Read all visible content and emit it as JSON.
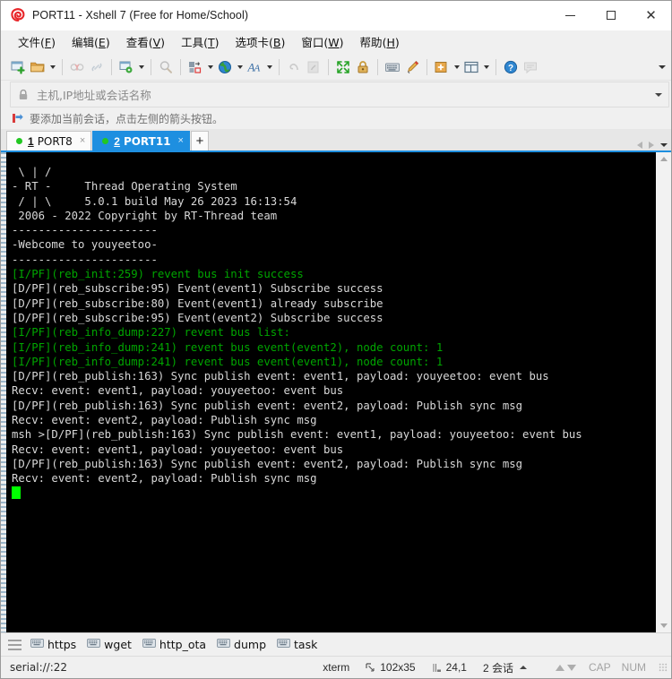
{
  "window": {
    "title": "PORT11 - Xshell 7 (Free for Home/School)",
    "logo_icon": "xshell-spiral-logo",
    "minimize_label": "Minimize",
    "maximize_label": "Maximize",
    "close_label": "Close"
  },
  "menu": {
    "items": [
      {
        "text": "文件",
        "accel": "F"
      },
      {
        "text": "编辑",
        "accel": "E"
      },
      {
        "text": "查看",
        "accel": "V"
      },
      {
        "text": "工具",
        "accel": "T"
      },
      {
        "text": "选项卡",
        "accel": "B"
      },
      {
        "text": "窗口",
        "accel": "W"
      },
      {
        "text": "帮助",
        "accel": "H"
      }
    ]
  },
  "toolbar": {
    "buttons": [
      {
        "icon": "new-session-icon",
        "label": "新建",
        "dropdown": false,
        "dim": false
      },
      {
        "icon": "open-folder-icon",
        "label": "打开",
        "dropdown": true,
        "dim": false
      },
      {
        "icon": "disconnect-icon",
        "label": "断开",
        "dim": true,
        "dropdown": false
      },
      {
        "icon": "reconnect-link-icon",
        "label": "重新连接",
        "dim": true,
        "dropdown": false
      },
      {
        "icon": "session-properties-icon",
        "label": "属性",
        "dropdown": true,
        "dim": false
      },
      {
        "icon": "search-icon",
        "label": "查找",
        "dim": true,
        "dropdown": false
      },
      {
        "icon": "layout-transfer-icon",
        "label": "传输",
        "dropdown": true,
        "dim": false
      },
      {
        "icon": "globe-icon",
        "label": "编码",
        "dropdown": true,
        "dim": false
      },
      {
        "icon": "font-icon",
        "label": "字体",
        "dropdown": true,
        "dim": false
      },
      {
        "icon": "undo-icon",
        "label": "撤销",
        "dim": true,
        "dropdown": false
      },
      {
        "icon": "paste-icon",
        "label": "粘贴",
        "dim": true,
        "dropdown": false
      },
      {
        "icon": "fullscreen-icon",
        "label": "全屏",
        "dim": false,
        "dropdown": false
      },
      {
        "icon": "lock-gold-icon",
        "label": "锁定",
        "dim": false,
        "dropdown": false
      },
      {
        "icon": "keyboard-icon",
        "label": "键盘",
        "dim": false,
        "dropdown": false
      },
      {
        "icon": "highlight-pen-icon",
        "label": "高亮",
        "dim": false,
        "dropdown": false
      },
      {
        "icon": "add-folder-icon",
        "label": "添加",
        "dropdown": true,
        "dim": false
      },
      {
        "icon": "split-layout-icon",
        "label": "布局",
        "dropdown": true,
        "dim": false
      },
      {
        "icon": "help-icon",
        "label": "帮助",
        "dim": false,
        "dropdown": false
      },
      {
        "icon": "chat-icon",
        "label": "聊天",
        "dim": true,
        "dropdown": false
      }
    ],
    "overflow_icon": "chevron-down-icon"
  },
  "address_bar": {
    "lock_icon": "lock-icon",
    "placeholder": "主机,IP地址或会话名称",
    "value": "",
    "dropdown_icon": "chevron-down-icon"
  },
  "hint": {
    "icon": "red-arrow-icon",
    "text": "要添加当前会话，点击左侧的箭头按钮。"
  },
  "tabs": {
    "items": [
      {
        "index": "1",
        "label": "PORT8",
        "active": false,
        "status": "connected",
        "close_label": "×"
      },
      {
        "index": "2",
        "label": "PORT11",
        "active": true,
        "status": "connected",
        "close_label": "×"
      }
    ],
    "add_label": "+",
    "nav_prev_icon": "chevron-left-icon",
    "nav_next_icon": "chevron-right-icon",
    "nav_menu_icon": "chevron-down-icon"
  },
  "terminal": {
    "background": "#000000",
    "fg_default": "#d8d8d8",
    "fg_info": "#00a500",
    "cursor_color": "#00ff00",
    "lines": [
      {
        "text": " \\ | /",
        "color": "default"
      },
      {
        "text": "- RT -     Thread Operating System",
        "color": "default"
      },
      {
        "text": " / | \\     5.0.1 build May 26 2023 16:13:54",
        "color": "default"
      },
      {
        "text": " 2006 - 2022 Copyright by RT-Thread team",
        "color": "default"
      },
      {
        "text": "----------------------",
        "color": "default"
      },
      {
        "text": "-Webcome to youyeetoo-",
        "color": "default"
      },
      {
        "text": "----------------------",
        "color": "default"
      },
      {
        "text": "[I/PF](reb_init:259) revent bus init success",
        "color": "info"
      },
      {
        "text": "[D/PF](reb_subscribe:95) Event(event1) Subscribe success",
        "color": "default"
      },
      {
        "text": "[D/PF](reb_subscribe:80) Event(event1) already subscribe",
        "color": "default"
      },
      {
        "text": "[D/PF](reb_subscribe:95) Event(event2) Subscribe success",
        "color": "default"
      },
      {
        "text": "[I/PF](reb_info_dump:227) revent bus list:",
        "color": "info"
      },
      {
        "text": "[I/PF](reb_info_dump:241) revent bus event(event2), node count: 1",
        "color": "info"
      },
      {
        "text": "[I/PF](reb_info_dump:241) revent bus event(event1), node count: 1",
        "color": "info"
      },
      {
        "text": "[D/PF](reb_publish:163) Sync publish event: event1, payload: youyeetoo: event bus",
        "color": "default"
      },
      {
        "text": "Recv: event: event1, payload: youyeetoo: event bus",
        "color": "default"
      },
      {
        "text": "[D/PF](reb_publish:163) Sync publish event: event2, payload: Publish sync msg",
        "color": "default"
      },
      {
        "text": "Recv: event: event2, payload: Publish sync msg",
        "color": "default"
      },
      {
        "text": "msh >[D/PF](reb_publish:163) Sync publish event: event1, payload: youyeetoo: event bus",
        "color": "default"
      },
      {
        "text": "Recv: event: event1, payload: youyeetoo: event bus",
        "color": "default"
      },
      {
        "text": "[D/PF](reb_publish:163) Sync publish event: event2, payload: Publish sync msg",
        "color": "default"
      },
      {
        "text": "Recv: event: event2, payload: Publish sync msg",
        "color": "default"
      }
    ],
    "scrollbar": {
      "up_icon": "scroll-up-icon",
      "down_icon": "scroll-down-icon"
    }
  },
  "quick_commands": {
    "menu_icon": "hamburger-icon",
    "items": [
      {
        "icon": "keyboard-icon",
        "label": "https"
      },
      {
        "icon": "keyboard-icon",
        "label": "wget"
      },
      {
        "icon": "keyboard-icon",
        "label": "http_ota"
      },
      {
        "icon": "keyboard-icon",
        "label": "dump"
      },
      {
        "icon": "keyboard-icon",
        "label": "task"
      }
    ]
  },
  "status_bar": {
    "connection": "serial://:22",
    "term_type": "xterm",
    "size_icon": "terminal-size-icon",
    "size": "102x35",
    "cursor_icon": "cursor-pos-icon",
    "cursor_pos": "24,1",
    "sessions": "2 会话",
    "sessions_caret_icon": "chevron-up-icon",
    "upload_icon": "arrow-up-icon",
    "download_icon": "arrow-down-icon",
    "cap": "CAP",
    "num": "NUM",
    "grip_icon": "resize-grip-icon"
  }
}
